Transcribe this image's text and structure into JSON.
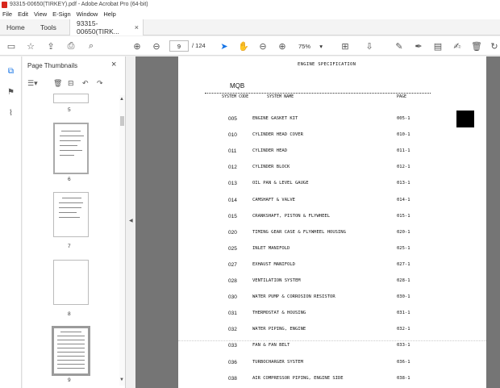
{
  "window": {
    "title": "93315-00650(TIRKEY).pdf - Adobe Acrobat Pro (64-bit)"
  },
  "menu": [
    "File",
    "Edit",
    "View",
    "E-Sign",
    "Window",
    "Help"
  ],
  "tabs": {
    "home": "Home",
    "tools": "Tools",
    "doc": "93315-00650(TIRK...",
    "close": "×"
  },
  "toolbar": {
    "page_current": "9",
    "page_total": "/ 124",
    "zoom": "75%",
    "icons": [
      "save-icon",
      "star-icon",
      "upload-icon",
      "print-icon",
      "search-icon",
      "page-up-icon",
      "page-down-icon",
      "select-arrow-icon",
      "hand-icon",
      "zoom-out-icon",
      "zoom-in-icon",
      "page-view-icon",
      "scroll-icon",
      "comment-icon",
      "pen-icon",
      "highlight-icon",
      "sign-icon",
      "delete-icon",
      "rotate-icon"
    ]
  },
  "panel": {
    "title": "Page Thumbnails",
    "close": "×",
    "thumbnails": [
      {
        "label": "5"
      },
      {
        "label": "6"
      },
      {
        "label": "7"
      },
      {
        "label": "8"
      },
      {
        "label": "9",
        "selected": true
      }
    ]
  },
  "document": {
    "heading": "ENGINE SPECIFICATION",
    "model": "MQB",
    "columns": {
      "code": "SYSTEM CODE",
      "name": "SYSTEM NAME",
      "page": "PAGE"
    },
    "rows": [
      {
        "code": "005",
        "name": "ENGINE GASKET KIT",
        "page": "005-1"
      },
      {
        "code": "010",
        "name": "CYLINDER HEAD COVER",
        "page": "010-1"
      },
      {
        "code": "011",
        "name": "CYLINDER HEAD",
        "page": "011-1"
      },
      {
        "code": "012",
        "name": "CYLINDER BLOCK",
        "page": "012-1"
      },
      {
        "code": "013",
        "name": "OIL PAN & LEVEL GAUGE",
        "page": "013-1"
      },
      {
        "code": "014",
        "name": "CAMSHAFT & VALVE",
        "page": "014-1"
      },
      {
        "code": "015",
        "name": "CRANKSHAFT, PISTON & FLYWHEEL",
        "page": "015-1"
      },
      {
        "code": "020",
        "name": "TIMING GEAR CASE & FLYWHEEL HOUSING",
        "page": "020-1"
      },
      {
        "code": "025",
        "name": "INLET MANIFOLD",
        "page": "025-1"
      },
      {
        "code": "027",
        "name": "EXHAUST MANIFOLD",
        "page": "027-1"
      },
      {
        "code": "028",
        "name": "VENTILATION SYSTEM",
        "page": "028-1"
      },
      {
        "code": "030",
        "name": "WATER PUMP & CORROSION RESISTOR",
        "page": "030-1"
      },
      {
        "code": "031",
        "name": "THERMOSTAT & HOUSING",
        "page": "031-1"
      },
      {
        "code": "032",
        "name": "WATER PIPING, ENGINE",
        "page": "032-1"
      },
      {
        "code": "033",
        "name": "FAN & FAN BELT",
        "page": "033-1"
      },
      {
        "code": "036",
        "name": "TURBOCHARGER SYSTEM",
        "page": "036-1"
      },
      {
        "code": "038",
        "name": "AIR COMPRESSOR PIPING, ENGINE SIDE",
        "page": "038-1"
      }
    ]
  }
}
